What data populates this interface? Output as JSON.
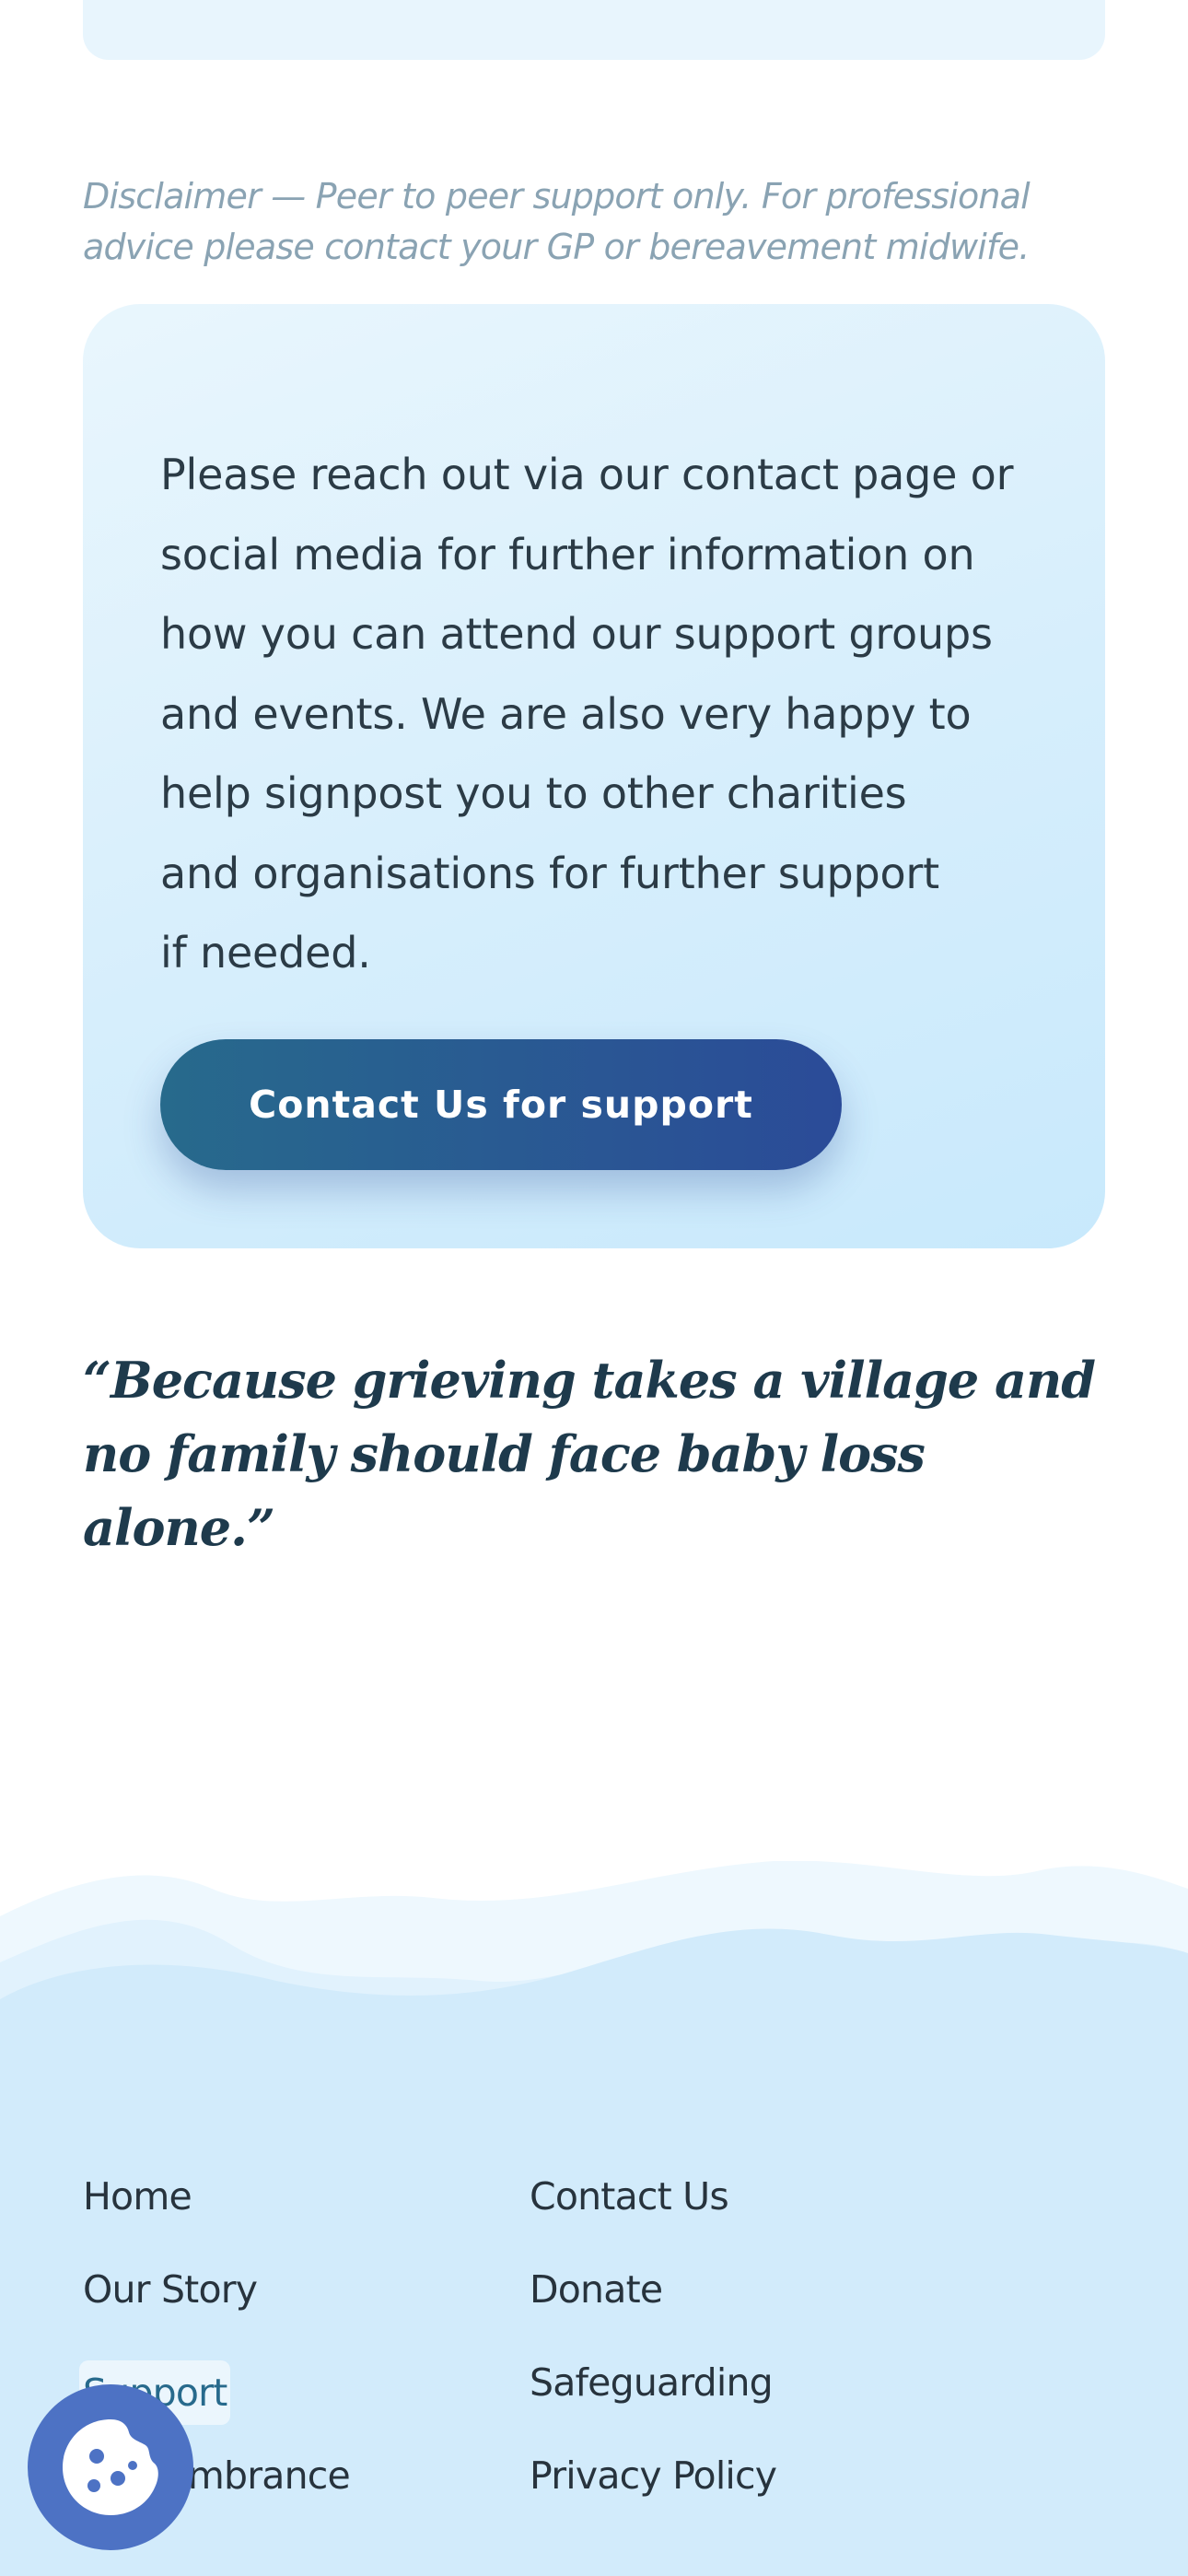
{
  "disclaimer": {
    "text": "Disclaimer — Peer to peer support only. For professional advice please contact your GP or bereavement midwife."
  },
  "support_card": {
    "text": "Please reach out via our contact page or\nsocial media for further information on\nhow you can attend our support groups\nand events. We are also very happy to\nhelp signpost you to other charities\nand organisations for further support\nif needed.",
    "button_label": "Contact Us for support"
  },
  "quote": {
    "text": "“Because grieving takes a village and no family should face baby loss alone.”"
  },
  "footer": {
    "left_links": [
      "Home",
      "Our Story",
      "Support",
      "Remembrance"
    ],
    "right_links": [
      "Contact Us",
      "Donate",
      "Safeguarding",
      "Privacy Policy"
    ]
  },
  "colors": {
    "accent": "#2b4b98",
    "accent_start": "#276a8c",
    "card_bg": "#d6eefc",
    "footer_bg": "#d2ebfb",
    "cookie_button": "#4d72c4"
  },
  "icons": {
    "cookie_button": "cookie-icon"
  }
}
